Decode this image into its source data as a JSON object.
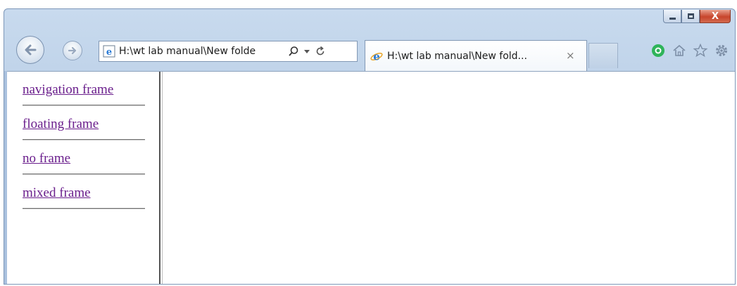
{
  "window": {
    "minimize_icon": "minimize-icon",
    "maximize_icon": "maximize-icon",
    "close_label": "X"
  },
  "toolbar": {
    "back_icon": "back-arrow-icon",
    "forward_icon": "forward-arrow-icon",
    "address": "H:\\wt lab manual\\New folde",
    "search_icon": "search-icon",
    "dropdown_icon": "dropdown-arrow-icon",
    "refresh_icon": "refresh-icon"
  },
  "tab": {
    "title": "H:\\wt lab manual\\New fold...",
    "close_label": "×"
  },
  "right_tools": {
    "icons": [
      "extension-icon",
      "home-icon",
      "favorites-star-icon",
      "settings-gear-icon"
    ]
  },
  "nav_frame": {
    "links": [
      {
        "label": "navigation frame"
      },
      {
        "label": "floating frame"
      },
      {
        "label": "no frame"
      },
      {
        "label": "mixed frame"
      }
    ]
  },
  "colors": {
    "visited_link": "#6a1e8c",
    "chrome_blue": "#b9cee6",
    "close_red": "#c8452c"
  }
}
